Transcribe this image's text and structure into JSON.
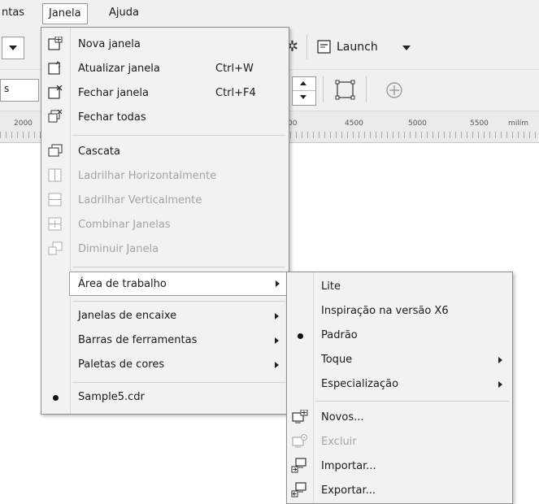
{
  "menubar": {
    "item1": "ntas",
    "item2": "Janela",
    "item3": "Ajuda"
  },
  "toolbar": {
    "launch_label": "Launch",
    "combo_left": "s"
  },
  "ruler": {
    "labels": [
      "2000",
      "00",
      "4500",
      "5000",
      "5500",
      "milím"
    ]
  },
  "window_menu": {
    "nova": {
      "label": "Nova janela"
    },
    "atualizar": {
      "label": "Atualizar janela",
      "shortcut": "Ctrl+W"
    },
    "fechar": {
      "label": "Fechar janela",
      "shortcut": "Ctrl+F4"
    },
    "fechar_todas": {
      "label": "Fechar todas"
    },
    "cascata": {
      "label": "Cascata"
    },
    "lad_h": {
      "label": "Ladrilhar Horizontalmente"
    },
    "lad_v": {
      "label": "Ladrilhar Verticalmente"
    },
    "combinar": {
      "label": "Combinar Janelas"
    },
    "diminuir": {
      "label": "Diminuir Janela"
    },
    "area": {
      "label": "Área de trabalho"
    },
    "encaixe": {
      "label": "Janelas de encaixe"
    },
    "barras": {
      "label": "Barras de ferramentas"
    },
    "paletas": {
      "label": "Paletas de cores"
    },
    "sample": {
      "label": "Sample5.cdr"
    }
  },
  "workspace_menu": {
    "lite": "Lite",
    "inspiracao": "Inspiração na versão X6",
    "padrao": "Padrão",
    "toque": "Toque",
    "especializacao": "Especialização",
    "novos": "Novos...",
    "excluir": "Excluir",
    "importar": "Importar...",
    "exportar": "Exportar..."
  },
  "colors": {
    "menu_bg": "#f2f2f2",
    "bar_bg": "#f0f0f0",
    "disabled_text": "#a3a3a3",
    "highlight_bg": "#ffffff"
  }
}
